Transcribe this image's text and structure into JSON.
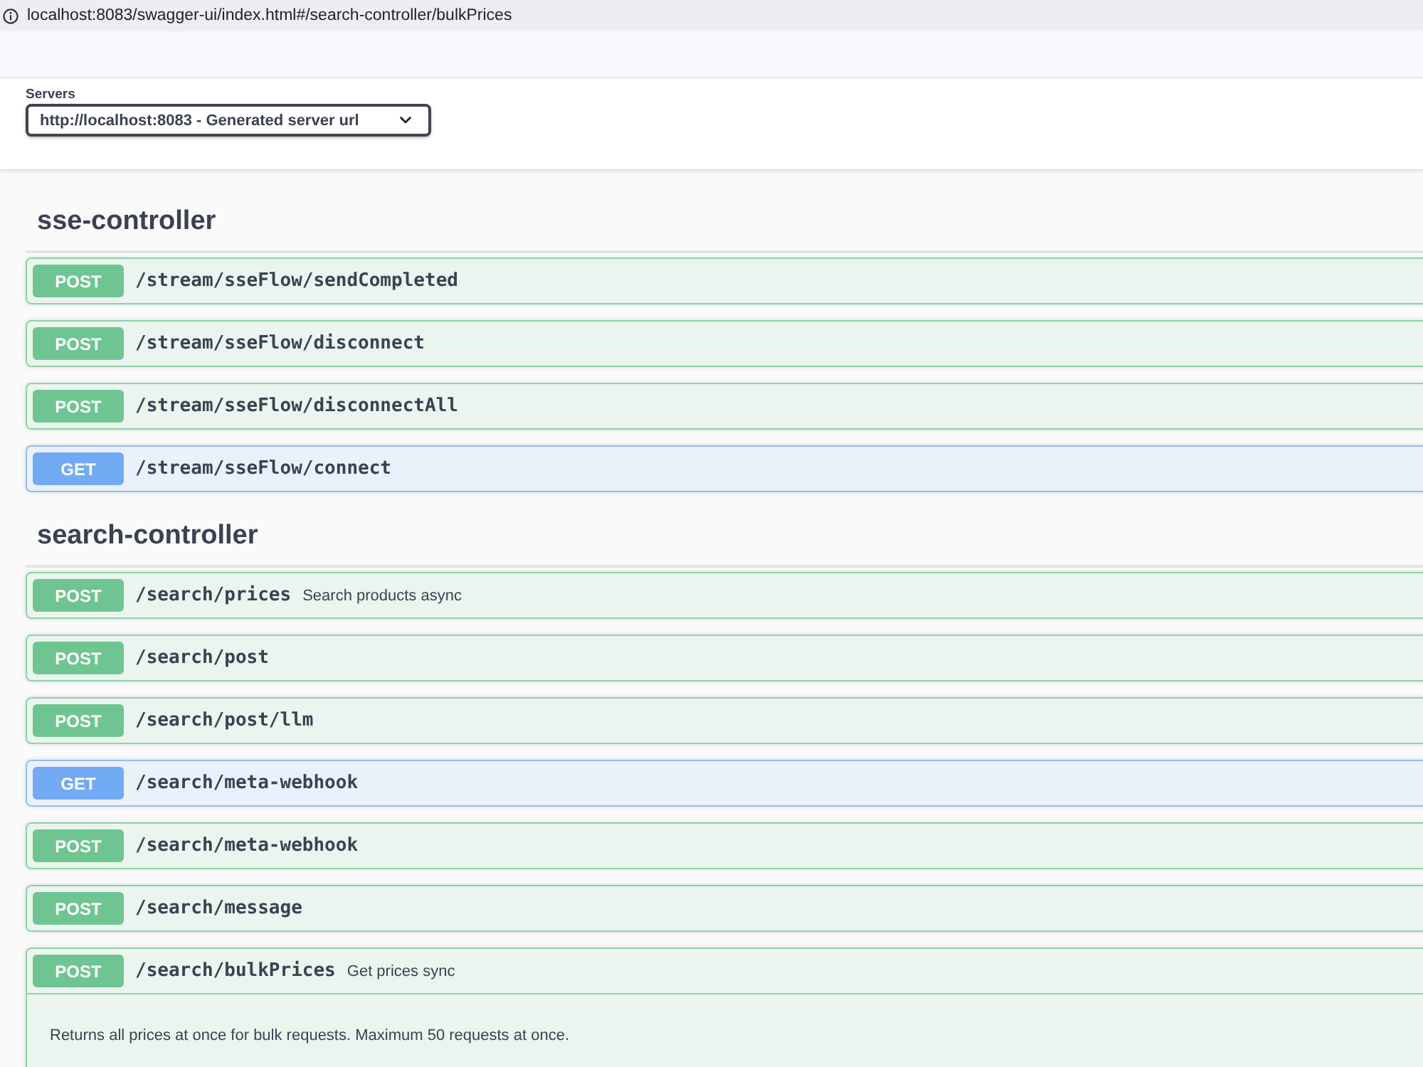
{
  "address_bar": {
    "url": "localhost:8083/swagger-ui/index.html#/search-controller/bulkPrices"
  },
  "servers": {
    "label": "Servers",
    "value": "http://localhost:8083 - Generated server url"
  },
  "tags": [
    {
      "name": "sse-controller",
      "operations": [
        {
          "kind": "post",
          "method": "POST",
          "path": "/stream/sseFlow/sendCompleted",
          "expanded": false
        },
        {
          "kind": "post",
          "method": "POST",
          "path": "/stream/sseFlow/disconnect",
          "expanded": false
        },
        {
          "kind": "post",
          "method": "POST",
          "path": "/stream/sseFlow/disconnectAll",
          "expanded": false
        },
        {
          "kind": "get",
          "method": "GET",
          "path": "/stream/sseFlow/connect",
          "expanded": false
        }
      ]
    },
    {
      "name": "search-controller",
      "operations": [
        {
          "kind": "post",
          "method": "POST",
          "path": "/search/prices",
          "summary": "Search products async",
          "expanded": false
        },
        {
          "kind": "post",
          "method": "POST",
          "path": "/search/post",
          "expanded": false
        },
        {
          "kind": "post",
          "method": "POST",
          "path": "/search/post/llm",
          "expanded": false
        },
        {
          "kind": "get",
          "method": "GET",
          "path": "/search/meta-webhook",
          "expanded": false
        },
        {
          "kind": "post",
          "method": "POST",
          "path": "/search/meta-webhook",
          "expanded": false
        },
        {
          "kind": "post",
          "method": "POST",
          "path": "/search/message",
          "expanded": false
        },
        {
          "kind": "post",
          "method": "POST",
          "path": "/search/bulkPrices",
          "summary": "Get prices sync",
          "expanded": true,
          "description": "Returns all prices at once for bulk requests. Maximum 50 requests at once."
        }
      ]
    }
  ]
}
